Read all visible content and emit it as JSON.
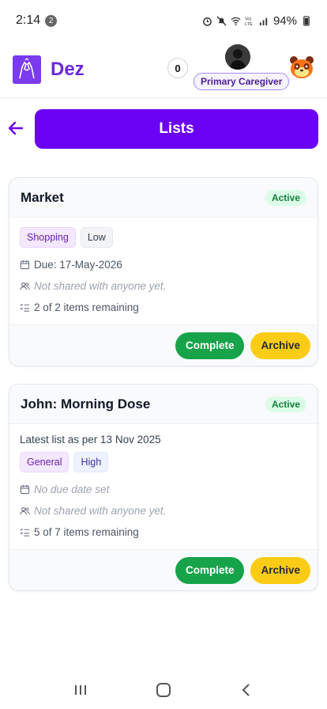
{
  "status_bar": {
    "time": "2:14",
    "notification_count": "2",
    "battery": "94%"
  },
  "header": {
    "app_name": "Dez",
    "count": "0",
    "role": "Primary Caregiver"
  },
  "page": {
    "title": "Lists"
  },
  "lists": [
    {
      "title": "Market",
      "status": "Active",
      "subtitle": "",
      "tags": [
        "Shopping",
        "Low"
      ],
      "due": "Due: 17-May-2026",
      "shared": "Not shared with anyone yet.",
      "remaining": "2 of 2 items remaining",
      "complete_label": "Complete",
      "archive_label": "Archive"
    },
    {
      "title": "John: Morning Dose",
      "status": "Active",
      "subtitle": "Latest list as per 13 Nov 2025",
      "tags": [
        "General",
        "High"
      ],
      "due": "No due date set",
      "shared": "Not shared with anyone yet.",
      "remaining": "5 of 7 items remaining",
      "complete_label": "Complete",
      "archive_label": "Archive"
    }
  ],
  "colors": {
    "brand": "#6a00f4",
    "active_badge": "#dcfce7",
    "complete": "#16a34a",
    "archive": "#facc15"
  },
  "icons": [
    "wifi-icon",
    "signal-icon",
    "battery-icon",
    "back-arrow-icon",
    "calendar-icon",
    "users-icon",
    "checklist-icon",
    "recents-icon",
    "home-icon",
    "back-icon"
  ]
}
